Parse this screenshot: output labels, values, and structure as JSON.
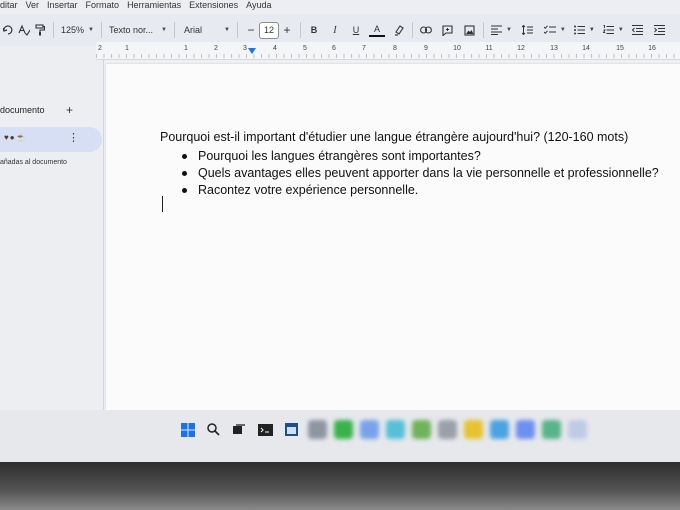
{
  "menubar": {
    "items": [
      "ditar",
      "Ver",
      "Insertar",
      "Formato",
      "Herramientas",
      "Extensiones",
      "Ayuda"
    ]
  },
  "toolbar": {
    "zoom": "125%",
    "style": "Texto nor...",
    "font": "Arial",
    "font_size": "12",
    "minus": "−",
    "plus": "+",
    "bold": "B",
    "italic": "I",
    "underline": "U",
    "text_color": "A",
    "icons": [
      "undo-redo-icon",
      "spellcheck-icon",
      "paint-format-icon",
      "highlighter-icon",
      "link-icon",
      "comment-icon",
      "image-icon",
      "align-icon",
      "line-spacing-icon",
      "checklist-icon",
      "bullet-list-icon",
      "numbered-list-icon",
      "indent-icon"
    ]
  },
  "ruler": {
    "labels": [
      "2",
      "1",
      "1",
      "2",
      "3",
      "4",
      "5",
      "6",
      "7",
      "8",
      "9",
      "10",
      "11",
      "12",
      "13",
      "14",
      "15",
      "16"
    ]
  },
  "sidepanel": {
    "title": "documento",
    "add": "+",
    "more": "⋮",
    "note": "añadas al documento"
  },
  "document": {
    "heading": "Pourquoi est-il important d'étudier une langue étrangère aujourd'hui?  (120-160 mots)",
    "bullets": [
      "Pourquoi les langues étrangères sont importantes?",
      "Quels avantages elles peuvent apporter dans la vie personnelle et professionnelle?",
      "Racontez votre expérience personnelle."
    ]
  },
  "taskbar": {
    "icons": [
      "windows-start-icon",
      "search-icon",
      "task-view-icon",
      "terminal-icon",
      "calendar-icon"
    ],
    "colors": {
      "start": "#1a73e8",
      "accent": "#1a73e8"
    }
  }
}
